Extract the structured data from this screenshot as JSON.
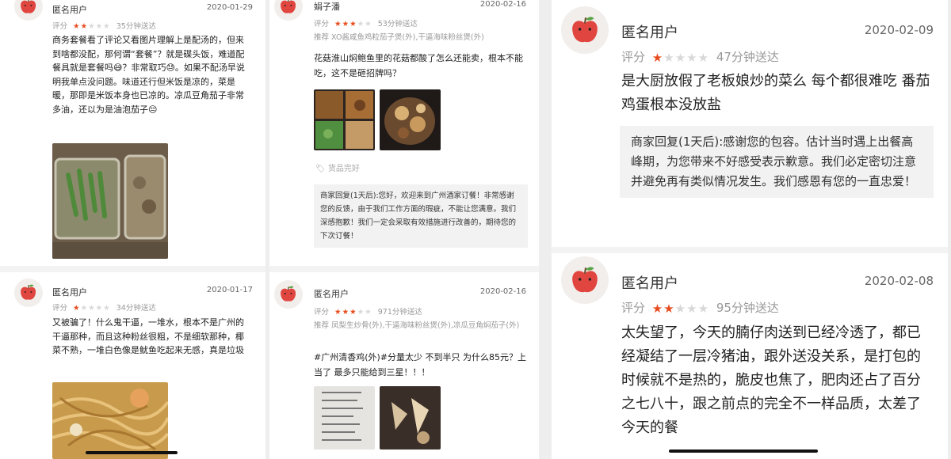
{
  "panels": [
    {
      "reviews": [
        {
          "user": "匿名用户",
          "date": "2020-01-29",
          "rating_label": "评分",
          "rating": 2,
          "delivery": "35分钟送达",
          "text": "商务套餐看了评论又看图片理解上是配汤的，但来到啥都没配，那何谓“套餐”？就是碟头饭，难道配餐具就是套餐吗😅？非常取巧😓。如果不配汤早说明我单点没问题。味道还行但米饭是凉的，菜是暖，那即是米饭本身也已凉的。凉瓜豆角茄子非常多油，还以为是油泡茄子😔"
        },
        {
          "user": "匿名用户",
          "date": "2020-01-17",
          "rating_label": "评分",
          "rating": 1,
          "delivery": "34分钟送达",
          "text": "又被骗了！什么鬼干逼，一堆水，根本不是广州的干逼那种，而且这种粉丝很粗，不是细软那种，椰菜不熟，一堆白色像是鱿鱼吃起来无感，真是垃圾"
        }
      ]
    },
    {
      "reviews": [
        {
          "user": "娟子潘",
          "date": "2020-02-16",
          "rating_label": "评分",
          "rating": 3,
          "delivery": "53分钟送达",
          "recommend_label": "推荐",
          "recommend": "XO酱咸鱼鸡粒茄子煲(外),干逼海味粉丝煲(外)",
          "text": "花菇淮山焖鲍鱼里的花菇都酸了怎么还能卖，根本不能吃，这不是砸招牌吗？",
          "tag": "货品完好",
          "reply": "商家回复(1天后):您好，欢迎来到广州酒家订餐！非常感谢您的反馈，由于我们工作方面的瑕疵，不能让您满意。我们深感抱歉！我们一定会采取有效措施进行改善的，期待您的下次订餐！"
        },
        {
          "user": "匿名用户",
          "date": "2020-02-16",
          "rating_label": "评分",
          "rating": 3,
          "delivery": "971分钟送达",
          "recommend_label": "推荐",
          "recommend": "凤梨生炒骨(外),干逼海味粉丝煲(外),凉瓜豆角焖茄子(外)",
          "text": "#广州清香鸡(外)#分量太少 不到半只 为什么85元？上当了 最多只能给到三星！！！"
        }
      ]
    },
    {
      "reviews": [
        {
          "user": "匿名用户",
          "date": "2020-02-09",
          "rating_label": "评分",
          "rating": 1,
          "delivery": "47分钟送达",
          "text": "是大厨放假了老板娘炒的菜么 每个都很难吃 番茄鸡蛋根本没放盐",
          "reply": "商家回复(1天后):感谢您的包容。估计当时遇上出餐高峰期，为您带来不好感受表示歉意。我们必定密切注意并避免再有类似情况发生。我们感恩有您的一直忠爱！"
        },
        {
          "user": "匿名用户",
          "date": "2020-02-08",
          "rating_label": "评分",
          "rating": 2,
          "delivery": "95分钟送达",
          "text": "太失望了，今天的腩仔肉送到已经冷透了，都已经凝结了一层冷猪油，跟外送没关系，是打包的时候就不是热的，脆皮也焦了，肥肉还占了百分之七八十，跟之前点的完全不一样品质，太差了今天的餐"
        }
      ]
    }
  ],
  "colors": {
    "star_on": "#e74c1f",
    "star_off": "#d8d8d8",
    "apple": "#e0463f"
  }
}
